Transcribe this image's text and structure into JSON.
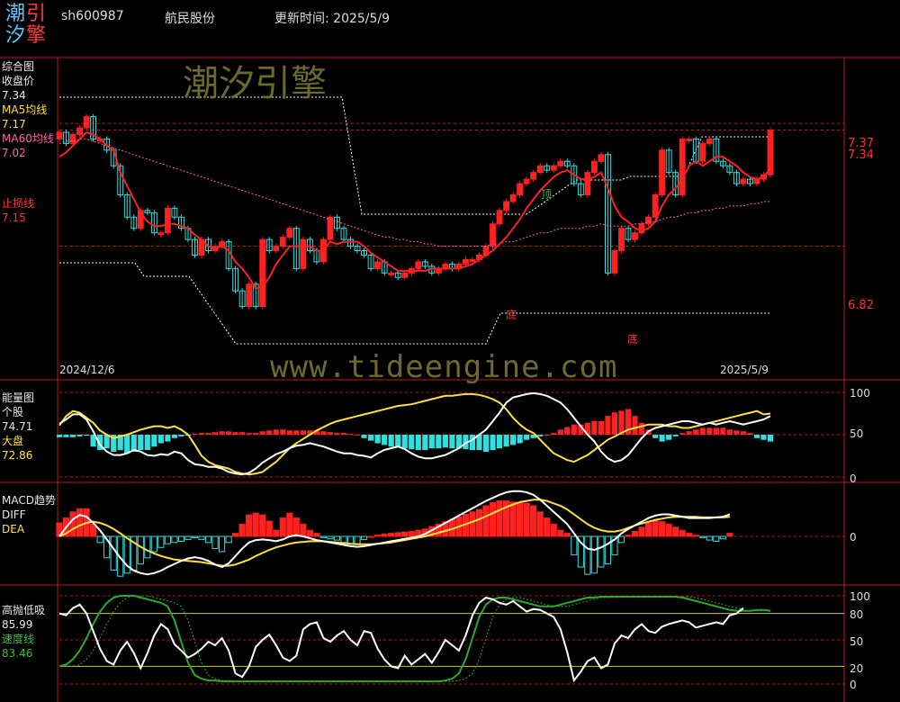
{
  "header": {
    "logo": [
      "潮",
      "引",
      "汐",
      "擎"
    ],
    "code": "sh600987",
    "name": "航民股份",
    "update_label": "更新时间: 2025/5/9"
  },
  "watermark": {
    "cn": "潮汐引擎",
    "url": "www.tideengine.com"
  },
  "colors": {
    "up": "#ff2020",
    "down": "#30e0e0",
    "ma5": "#ffe040",
    "ma60": "#ff60b0",
    "stop": "#ff3030",
    "grid": "#aa2020",
    "white": "#ffffff",
    "green": "#2ea82e"
  },
  "panels": {
    "main": {
      "labels": [
        "综合图",
        "收盘价",
        "7.34",
        "MA5均线",
        "7.17",
        "MA60均线",
        "7.02",
        "止损线",
        "7.15"
      ],
      "right_labels": [
        "7.37",
        "7.34",
        "6.82"
      ],
      "date_start": "2024/12/6",
      "date_end": "2025/5/9",
      "marks": {
        "top": "顶",
        "bottom1": "底",
        "bottom2": "底"
      }
    },
    "energy": {
      "labels": [
        "能量图",
        "个股",
        "74.71",
        "大盘",
        "72.86"
      ],
      "ticks": [
        "100",
        "50",
        "0"
      ]
    },
    "macd": {
      "labels": [
        "MACD趋势",
        "DIFF",
        "DEA"
      ],
      "ticks": [
        "0"
      ]
    },
    "hilo": {
      "labels": [
        "高抛低吸",
        "85.99",
        "速度线",
        "83.46"
      ],
      "ticks": [
        "100",
        "80",
        "50",
        "20",
        "0"
      ]
    }
  },
  "chart_data": [
    {
      "type": "candlestick",
      "title": "综合图",
      "x_range": [
        "2024/12/6",
        "2025/5/9"
      ],
      "ylim": [
        6.25,
        7.6
      ],
      "close_last": 7.34,
      "ma5_last": 7.17,
      "ma60_last": 7.02,
      "stop_last": 7.15,
      "levels": [
        7.37,
        7.34,
        6.82
      ],
      "closes": [
        7.33,
        7.28,
        7.32,
        7.35,
        7.4,
        7.3,
        7.3,
        7.25,
        7.18,
        7.05,
        6.95,
        6.9,
        6.98,
        6.97,
        6.88,
        6.88,
        6.99,
        6.95,
        6.9,
        6.85,
        6.78,
        6.85,
        6.8,
        6.82,
        6.84,
        6.72,
        6.62,
        6.55,
        6.65,
        6.55,
        6.85,
        6.8,
        6.82,
        6.86,
        6.9,
        6.72,
        6.85,
        6.8,
        6.75,
        6.85,
        6.95,
        6.9,
        6.85,
        6.82,
        6.8,
        6.78,
        6.72,
        6.75,
        6.7,
        6.7,
        6.68,
        6.7,
        6.72,
        6.75,
        6.73,
        6.7,
        6.72,
        6.74,
        6.72,
        6.74,
        6.76,
        6.76,
        6.78,
        6.82,
        6.92,
        6.98,
        7.02,
        7.05,
        7.1,
        7.12,
        7.15,
        7.18,
        7.16,
        7.18,
        7.2,
        7.18,
        7.1,
        7.05,
        7.15,
        7.2,
        7.23,
        6.7,
        6.8,
        6.9,
        6.85,
        6.88,
        6.92,
        6.95,
        7.05,
        7.25,
        7.15,
        7.05,
        7.3,
        7.3,
        7.2,
        7.28,
        7.3,
        7.2,
        7.18,
        7.15,
        7.1,
        7.12,
        7.1,
        7.12,
        7.14,
        7.34
      ],
      "ma5": [
        7.22,
        7.24,
        7.27,
        7.3,
        7.33,
        7.32,
        7.3,
        7.27,
        7.25,
        7.15,
        7.09,
        7.03,
        6.97,
        6.93,
        6.91,
        6.91,
        6.92,
        6.92,
        6.91,
        6.9,
        6.87,
        6.85,
        6.82,
        6.81,
        6.82,
        6.8,
        6.75,
        6.72,
        6.68,
        6.63,
        6.64,
        6.68,
        6.74,
        6.78,
        6.82,
        6.82,
        6.82,
        6.82,
        6.8,
        6.8,
        6.84,
        6.83,
        6.84,
        6.84,
        6.84,
        6.82,
        6.79,
        6.77,
        6.75,
        6.73,
        6.71,
        6.71,
        6.71,
        6.71,
        6.71,
        6.72,
        6.72,
        6.72,
        6.72,
        6.72,
        6.73,
        6.74,
        6.76,
        6.78,
        6.8,
        6.83,
        6.86,
        6.9,
        6.94,
        6.99,
        7.03,
        7.07,
        7.1,
        7.13,
        7.15,
        7.16,
        7.14,
        7.12,
        7.12,
        7.13,
        7.15,
        7.08,
        7.0,
        6.95,
        6.93,
        6.9,
        6.89,
        6.9,
        6.93,
        7.0,
        7.05,
        7.08,
        7.12,
        7.18,
        7.2,
        7.18,
        7.2,
        7.22,
        7.22,
        7.2,
        7.18,
        7.15,
        7.13,
        7.12,
        7.13,
        7.17
      ],
      "ma60": [
        7.28,
        7.29,
        7.29,
        7.3,
        7.3,
        7.29,
        7.28,
        7.27,
        7.26,
        7.25,
        7.24,
        7.23,
        7.22,
        7.21,
        7.2,
        7.19,
        7.18,
        7.17,
        7.16,
        7.15,
        7.14,
        7.13,
        7.12,
        7.11,
        7.1,
        7.09,
        7.08,
        7.07,
        7.06,
        7.05,
        7.04,
        7.03,
        7.02,
        7.01,
        7.0,
        6.99,
        6.98,
        6.97,
        6.96,
        6.95,
        6.94,
        6.93,
        6.92,
        6.91,
        6.9,
        6.89,
        6.88,
        6.87,
        6.86,
        6.86,
        6.85,
        6.85,
        6.84,
        6.84,
        6.83,
        6.83,
        6.82,
        6.82,
        6.82,
        6.82,
        6.82,
        6.82,
        6.82,
        6.82,
        6.83,
        6.83,
        6.84,
        6.84,
        6.85,
        6.86,
        6.87,
        6.88,
        6.88,
        6.89,
        6.9,
        6.9,
        6.9,
        6.9,
        6.91,
        6.91,
        6.92,
        6.91,
        6.91,
        6.91,
        6.91,
        6.92,
        6.92,
        6.93,
        6.93,
        6.94,
        6.95,
        6.95,
        6.96,
        6.97,
        6.97,
        6.98,
        6.98,
        6.99,
        6.99,
        7.0,
        7.0,
        7.0,
        7.01,
        7.01,
        7.02,
        7.02
      ]
    },
    {
      "type": "bar+line",
      "title": "能量图",
      "ylim": [
        0,
        100
      ],
      "stock_last": 74.71,
      "market_last": 72.86,
      "bars": [
        -3,
        -3,
        -3,
        -2,
        -1,
        -14,
        -18,
        -16,
        -20,
        -18,
        -22,
        -20,
        -18,
        -18,
        -14,
        -10,
        -8,
        -4,
        -2,
        -1,
        1,
        2,
        2,
        3,
        4,
        4,
        3,
        3,
        2,
        2,
        4,
        5,
        6,
        6,
        5,
        5,
        5,
        5,
        5,
        4,
        3,
        2,
        2,
        1,
        0,
        -4,
        -7,
        -10,
        -12,
        -14,
        -15,
        -16,
        -17,
        -18,
        -18,
        -16,
        -16,
        -15,
        -16,
        -16,
        -17,
        -18,
        -18,
        -20,
        -18,
        -16,
        -14,
        -12,
        -10,
        -6,
        -4,
        -2,
        0,
        2,
        6,
        9,
        12,
        12,
        14,
        16,
        16,
        22,
        26,
        28,
        30,
        22,
        14,
        6,
        -4,
        -8,
        -6,
        -2,
        2,
        4,
        6,
        8,
        8,
        8,
        8,
        6,
        5,
        4,
        2,
        -4,
        -6,
        -8
      ],
      "stock": [
        63,
        68,
        74,
        74,
        68,
        54,
        38,
        30,
        26,
        26,
        28,
        32,
        30,
        26,
        25,
        27,
        26,
        30,
        28,
        20,
        15,
        14,
        12,
        12,
        10,
        6,
        4,
        3,
        5,
        10,
        17,
        22,
        27,
        30,
        34,
        37,
        38,
        40,
        38,
        36,
        33,
        30,
        28,
        28,
        26,
        25,
        23,
        28,
        32,
        34,
        36,
        33,
        28,
        24,
        22,
        22,
        24,
        26,
        30,
        34,
        40,
        44,
        50,
        56,
        66,
        76,
        88,
        94,
        96,
        98,
        99,
        98,
        96,
        92,
        88,
        80,
        70,
        60,
        50,
        42,
        30,
        22,
        18,
        20,
        26,
        36,
        46,
        54,
        58,
        60,
        62,
        64,
        66,
        66,
        64,
        62,
        64,
        62,
        64,
        66,
        64,
        62,
        64,
        66,
        68,
        72
      ],
      "market": [
        61,
        72,
        78,
        76,
        70,
        64,
        55,
        50,
        46,
        48,
        50,
        53,
        56,
        58,
        60,
        60,
        58,
        60,
        56,
        50,
        38,
        25,
        18,
        14,
        12,
        10,
        6,
        4,
        3,
        4,
        6,
        12,
        18,
        26,
        34,
        40,
        45,
        50,
        55,
        59,
        63,
        66,
        68,
        70,
        72,
        74,
        76,
        78,
        80,
        82,
        84,
        85,
        86,
        88,
        90,
        92,
        94,
        96,
        96,
        97,
        98,
        98,
        97,
        95,
        92,
        88,
        80,
        70,
        62,
        56,
        52,
        44,
        36,
        28,
        24,
        20,
        18,
        22,
        26,
        32,
        38,
        44,
        48,
        52,
        56,
        58,
        60,
        62,
        62,
        62,
        60,
        60,
        58,
        58,
        60,
        62,
        64,
        66,
        68,
        70,
        72,
        74,
        76,
        78,
        74,
        75
      ]
    },
    {
      "type": "bar+line",
      "title": "MACD趋势",
      "ylim": [
        -1,
        1
      ],
      "hist": [
        0.22,
        0.3,
        0.4,
        0.45,
        0.45,
        0.2,
        -0.1,
        -0.35,
        -0.55,
        -0.65,
        -0.6,
        -0.55,
        -0.45,
        -0.35,
        -0.25,
        -0.18,
        -0.12,
        -0.1,
        -0.08,
        -0.05,
        -0.02,
        -0.05,
        -0.1,
        -0.2,
        -0.25,
        -0.1,
        0.05,
        0.2,
        0.35,
        0.38,
        0.35,
        0.25,
        0.1,
        0.3,
        0.38,
        0.3,
        0.2,
        0.1,
        0.05,
        -0.02,
        -0.04,
        -0.06,
        -0.1,
        -0.12,
        -0.12,
        -0.05,
        0.0,
        0.02,
        0.04,
        0.05,
        0.06,
        0.07,
        0.08,
        0.1,
        0.12,
        0.16,
        0.2,
        0.24,
        0.28,
        0.32,
        0.36,
        0.4,
        0.44,
        0.5,
        0.55,
        0.58,
        0.58,
        0.56,
        0.55,
        0.54,
        0.5,
        0.4,
        0.3,
        0.2,
        0.1,
        0.05,
        -0.3,
        -0.5,
        -0.62,
        -0.6,
        -0.5,
        -0.45,
        -0.3,
        -0.1,
        0.02,
        0.08,
        0.15,
        0.22,
        0.26,
        0.24,
        0.2,
        0.15,
        0.1,
        0.05,
        0.02,
        -0.02,
        -0.06,
        -0.08,
        -0.04,
        0.05
      ],
      "diff": [
        0.0,
        0.15,
        0.28,
        0.35,
        0.32,
        0.22,
        0.1,
        -0.05,
        -0.2,
        -0.35,
        -0.48,
        -0.56,
        -0.6,
        -0.62,
        -0.6,
        -0.56,
        -0.5,
        -0.45,
        -0.4,
        -0.36,
        -0.34,
        -0.36,
        -0.4,
        -0.46,
        -0.5,
        -0.44,
        -0.32,
        -0.2,
        -0.1,
        -0.06,
        -0.05,
        -0.06,
        -0.08,
        -0.05,
        0.0,
        0.02,
        0.0,
        -0.03,
        -0.06,
        -0.08,
        -0.1,
        -0.12,
        -0.14,
        -0.16,
        -0.17,
        -0.16,
        -0.14,
        -0.12,
        -0.1,
        -0.08,
        -0.06,
        -0.04,
        -0.02,
        0.0,
        0.04,
        0.1,
        0.16,
        0.22,
        0.28,
        0.34,
        0.4,
        0.46,
        0.52,
        0.58,
        0.63,
        0.68,
        0.72,
        0.74,
        0.74,
        0.72,
        0.68,
        0.6,
        0.5,
        0.4,
        0.3,
        0.2,
        0.05,
        -0.1,
        -0.2,
        -0.22,
        -0.18,
        -0.12,
        -0.05,
        0.05,
        0.12,
        0.18,
        0.24,
        0.3,
        0.34,
        0.36,
        0.36,
        0.34,
        0.32,
        0.3,
        0.3,
        0.3,
        0.3,
        0.31,
        0.32,
        0.36
      ],
      "dea": [
        0.0,
        0.05,
        0.12,
        0.18,
        0.22,
        0.24,
        0.22,
        0.18,
        0.12,
        0.05,
        -0.03,
        -0.1,
        -0.17,
        -0.23,
        -0.28,
        -0.32,
        -0.35,
        -0.38,
        -0.39,
        -0.4,
        -0.41,
        -0.42,
        -0.44,
        -0.46,
        -0.48,
        -0.48,
        -0.46,
        -0.42,
        -0.38,
        -0.32,
        -0.27,
        -0.22,
        -0.18,
        -0.15,
        -0.12,
        -0.1,
        -0.09,
        -0.08,
        -0.08,
        -0.08,
        -0.09,
        -0.1,
        -0.11,
        -0.12,
        -0.13,
        -0.13,
        -0.13,
        -0.12,
        -0.11,
        -0.1,
        -0.08,
        -0.06,
        -0.04,
        -0.02,
        0.0,
        0.03,
        0.06,
        0.09,
        0.12,
        0.16,
        0.2,
        0.24,
        0.28,
        0.33,
        0.38,
        0.43,
        0.48,
        0.52,
        0.56,
        0.58,
        0.6,
        0.6,
        0.58,
        0.54,
        0.5,
        0.44,
        0.36,
        0.28,
        0.2,
        0.14,
        0.1,
        0.08,
        0.08,
        0.1,
        0.14,
        0.18,
        0.21,
        0.24,
        0.27,
        0.29,
        0.31,
        0.32,
        0.32,
        0.32,
        0.32,
        0.31,
        0.31,
        0.31,
        0.31,
        0.32
      ]
    },
    {
      "type": "line",
      "title": "高抛低吸",
      "ylim": [
        0,
        100
      ],
      "levels": [
        100,
        80,
        50,
        20,
        0
      ],
      "last": 85.99,
      "speed_last": 83.46,
      "white": [
        80,
        78,
        86,
        90,
        80,
        60,
        40,
        26,
        22,
        38,
        48,
        35,
        18,
        35,
        55,
        68,
        62,
        45,
        38,
        30,
        34,
        40,
        48,
        44,
        52,
        38,
        12,
        8,
        20,
        42,
        50,
        56,
        44,
        30,
        26,
        32,
        62,
        68,
        70,
        52,
        48,
        55,
        60,
        50,
        44,
        60,
        58,
        40,
        28,
        20,
        18,
        32,
        22,
        28,
        34,
        24,
        36,
        50,
        44,
        38,
        55,
        78,
        92,
        98,
        96,
        92,
        90,
        94,
        88,
        82,
        85,
        84,
        80,
        76,
        62,
        36,
        4,
        14,
        26,
        30,
        18,
        22,
        46,
        55,
        52,
        62,
        68,
        60,
        58,
        65,
        68,
        70,
        72,
        70,
        64,
        66,
        68,
        70,
        68,
        78,
        80,
        86
      ],
      "green": [
        20,
        22,
        28,
        38,
        52,
        68,
        82,
        92,
        98,
        100,
        100,
        100,
        98,
        96,
        94,
        92,
        88,
        72,
        48,
        24,
        10,
        6,
        4,
        4,
        3,
        3,
        3,
        3,
        3,
        3,
        3,
        3,
        3,
        3,
        3,
        3,
        3,
        3,
        3,
        3,
        3,
        3,
        3,
        3,
        3,
        3,
        3,
        3,
        3,
        3,
        3,
        3,
        3,
        3,
        3,
        3,
        3,
        4,
        6,
        12,
        28,
        52,
        76,
        90,
        96,
        98,
        98,
        96,
        94,
        92,
        90,
        88,
        88,
        88,
        90,
        92,
        94,
        96,
        98,
        98,
        99,
        99,
        99,
        99,
        99,
        99,
        99,
        99,
        99,
        99,
        99,
        99,
        98,
        96,
        94,
        92,
        90,
        88,
        86,
        84,
        83,
        83,
        83,
        84,
        84,
        83
      ]
    }
  ]
}
